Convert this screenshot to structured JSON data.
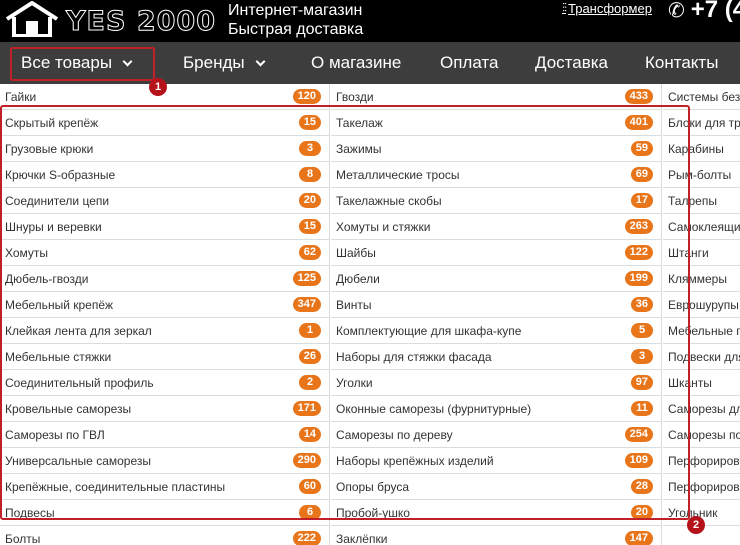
{
  "header": {
    "logo_text": "YES 2000",
    "tagline_1": "Интернет-магазин",
    "tagline_2": "Быстрая доставка",
    "transformer_label": "Трансформер",
    "phone_partial": "+7 (4"
  },
  "nav": [
    {
      "label": "Все товары",
      "has_dropdown": true
    },
    {
      "label": "Бренды",
      "has_dropdown": true
    },
    {
      "label": "О магазине",
      "has_dropdown": false
    },
    {
      "label": "Оплата",
      "has_dropdown": false
    },
    {
      "label": "Доставка",
      "has_dropdown": false
    },
    {
      "label": "Контакты",
      "has_dropdown": false
    }
  ],
  "columns": [
    [
      {
        "name": "Гайки",
        "count": "120"
      },
      {
        "name": "Скрытый крепёж",
        "count": "15"
      },
      {
        "name": "Грузовые крюки",
        "count": "3"
      },
      {
        "name": "Крючки S-образные",
        "count": "8"
      },
      {
        "name": "Соединители цепи",
        "count": "20"
      },
      {
        "name": "Шнуры и веревки",
        "count": "15"
      },
      {
        "name": "Хомуты",
        "count": "62"
      },
      {
        "name": "Дюбель-гвозди",
        "count": "125"
      },
      {
        "name": "Мебельный крепёж",
        "count": "347"
      },
      {
        "name": "Клейкая лента для зеркал",
        "count": "1"
      },
      {
        "name": "Мебельные стяжки",
        "count": "26"
      },
      {
        "name": "Соединительный профиль",
        "count": "2"
      },
      {
        "name": "Кровельные саморезы",
        "count": "171"
      },
      {
        "name": "Саморезы по ГВЛ",
        "count": "14"
      },
      {
        "name": "Универсальные саморезы",
        "count": "290"
      },
      {
        "name": "Крепёжные, соединительные пластины",
        "count": "60"
      },
      {
        "name": "Подвесы",
        "count": "6"
      },
      {
        "name": "Болты",
        "count": "222"
      }
    ],
    [
      {
        "name": "Гвозди",
        "count": "433"
      },
      {
        "name": "Такелаж",
        "count": "401"
      },
      {
        "name": "Зажимы",
        "count": "59"
      },
      {
        "name": "Металлические тросы",
        "count": "69"
      },
      {
        "name": "Такелажные скобы",
        "count": "17"
      },
      {
        "name": "Хомуты и стяжки",
        "count": "263"
      },
      {
        "name": "Шайбы",
        "count": "122"
      },
      {
        "name": "Дюбели",
        "count": "199"
      },
      {
        "name": "Винты",
        "count": "36"
      },
      {
        "name": "Комплектующие для шкафа-купе",
        "count": "5"
      },
      {
        "name": "Наборы для стяжки фасада",
        "count": "3"
      },
      {
        "name": "Уголки",
        "count": "97"
      },
      {
        "name": "Оконные саморезы (фурнитурные)",
        "count": "11"
      },
      {
        "name": "Саморезы по дереву",
        "count": "254"
      },
      {
        "name": "Наборы крепёжных изделий",
        "count": "109"
      },
      {
        "name": "Опоры бруса",
        "count": "28"
      },
      {
        "name": "Пробой-ушко",
        "count": "20"
      },
      {
        "name": "Заклёпки",
        "count": "147"
      }
    ],
    [
      {
        "name": "Системы безопасности",
        "count": ""
      },
      {
        "name": "Блоки для тросов",
        "count": ""
      },
      {
        "name": "Карабины",
        "count": ""
      },
      {
        "name": "Рым-болты",
        "count": ""
      },
      {
        "name": "Талрепы",
        "count": ""
      },
      {
        "name": "Самоклеящиеся",
        "count": ""
      },
      {
        "name": "Штанги",
        "count": ""
      },
      {
        "name": "Кляммеры",
        "count": ""
      },
      {
        "name": "Еврошурупы",
        "count": ""
      },
      {
        "name": "Мебельные петли",
        "count": ""
      },
      {
        "name": "Подвески для",
        "count": ""
      },
      {
        "name": "Шканты",
        "count": ""
      },
      {
        "name": "Саморезы для",
        "count": ""
      },
      {
        "name": "Саморезы по",
        "count": ""
      },
      {
        "name": "Перфорированные",
        "count": ""
      },
      {
        "name": "Перфорированные",
        "count": ""
      },
      {
        "name": "Угольник",
        "count": ""
      },
      {
        "name": "",
        "count": ""
      }
    ]
  ],
  "annotations": {
    "marker_1": "1",
    "marker_2": "2"
  },
  "colors": {
    "badge": "#e8751a",
    "nav_bg": "#3d3d3d",
    "header_bg": "#000000",
    "annotation": "#c0202a"
  }
}
